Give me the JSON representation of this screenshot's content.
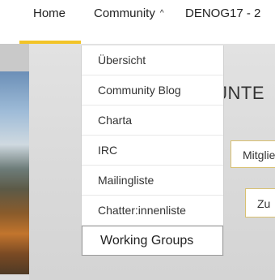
{
  "nav": {
    "home": "Home",
    "community": "Community",
    "community_chevron": "^",
    "denog": "DENOG17 - 2"
  },
  "colors": {
    "accent": "#f2c428",
    "button_border": "#d8c070"
  },
  "dropdown": {
    "items": [
      {
        "label": "Übersicht"
      },
      {
        "label": "Community Blog"
      },
      {
        "label": "Charta"
      },
      {
        "label": "IRC"
      },
      {
        "label": "Mailingliste"
      },
      {
        "label": "Chatter:innenliste"
      },
      {
        "label": "Working Groups"
      }
    ]
  },
  "hero": {
    "headline": "JNTE",
    "button_mitglied": "Mitglie",
    "button_zu": "Zu"
  }
}
